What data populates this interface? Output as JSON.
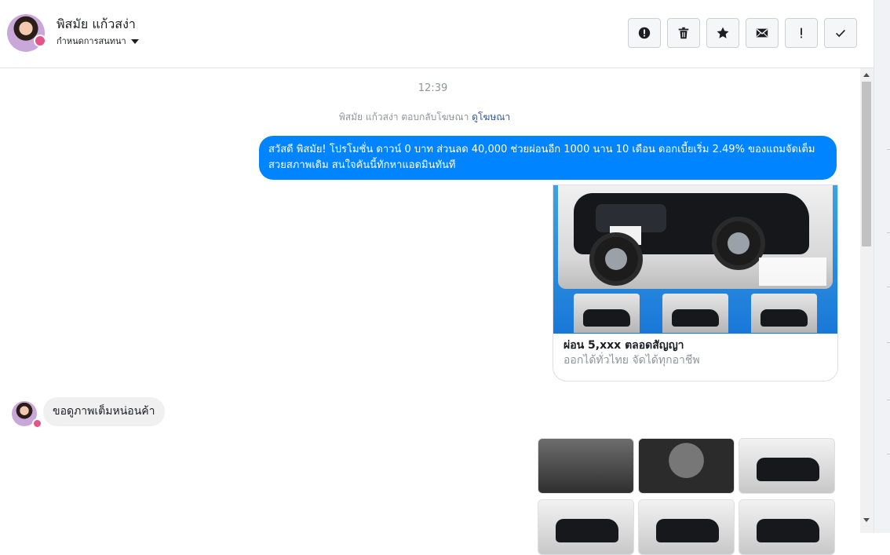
{
  "header": {
    "contact_name": "พิสมัย แก้วสง่า",
    "assign_label": "กำหนดการสนทนา",
    "toolbar": [
      {
        "name": "alert-circle-icon"
      },
      {
        "name": "trash-icon"
      },
      {
        "name": "star-icon"
      },
      {
        "name": "envelope-icon"
      },
      {
        "name": "exclamation-icon"
      },
      {
        "name": "checkmark-icon"
      }
    ]
  },
  "conversation": {
    "timestamp": "12:39",
    "reply_note": "พิสมัย แก้วสง่า ตอบกลับโฆษณา",
    "view_ad_link": "ดูโฆษณา",
    "outgoing_message": "สวัสดี พิสมัย! โปรโมชั่น ดาวน์ 0 บาท ส่วนลด 40,000 ช่วยผ่อนอีก 1000 นาน 10 เดือน ดอกเบี้ยเริ่ม 2.49% ของแถมจัดเต็ม สวยสภาพเดิม สนใจคันนี้ทักหาแอดมินทันที",
    "ad_card": {
      "title": "ผ่อน 5,xxx ตลอดสัญญา",
      "subtitle": "ออกได้ทั่วไทย จัดได้ทุกอาชีพ"
    },
    "incoming_message": "ขอดูภาพเต็มหน่อนค้า"
  },
  "colors": {
    "outgoing_bubble": "#0084ff",
    "incoming_bubble": "#f1f0f0",
    "link": "#385898"
  }
}
